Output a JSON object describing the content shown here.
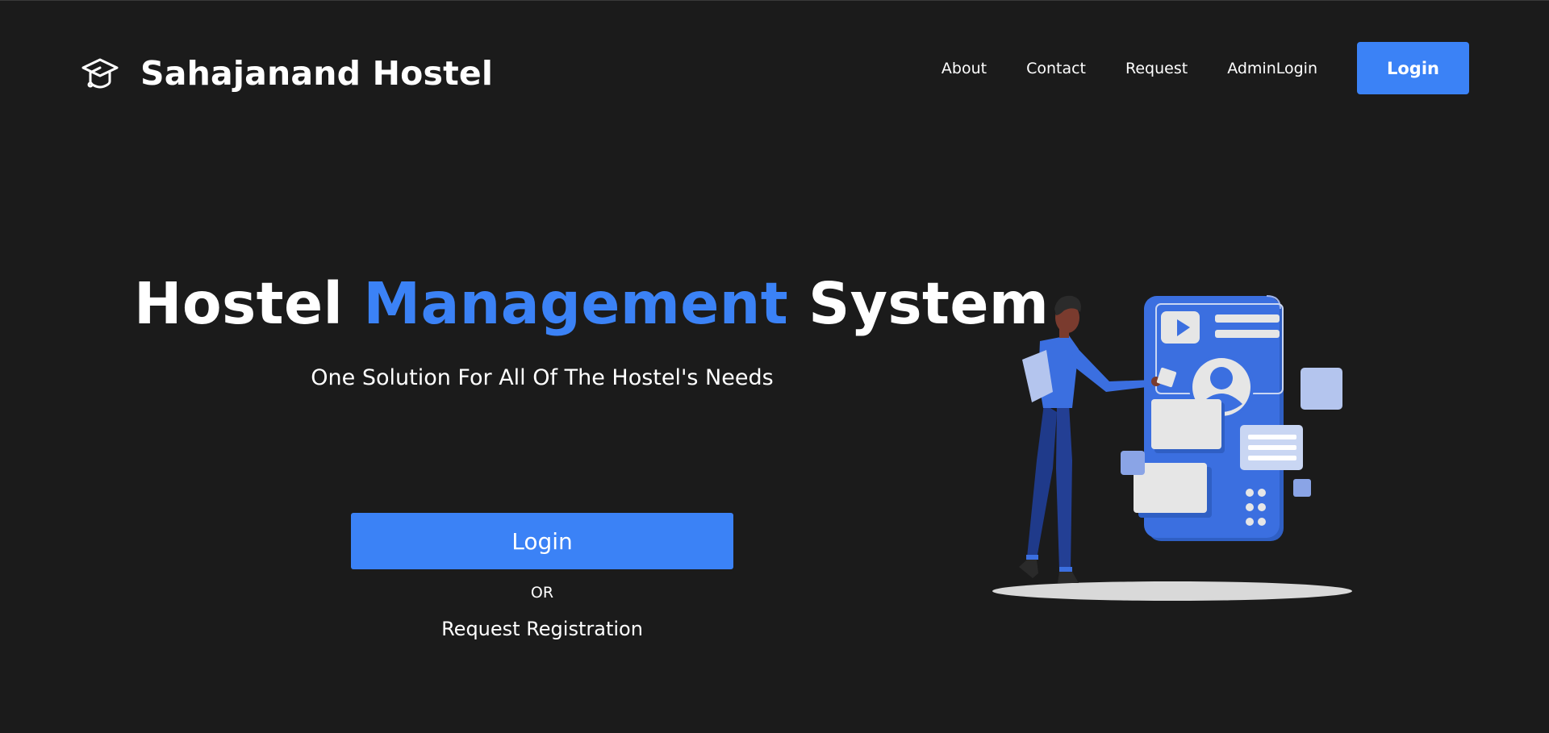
{
  "header": {
    "brand_name": "Sahajanand Hostel",
    "brand_icon": "graduation-cap-icon",
    "nav": [
      {
        "label": "About"
      },
      {
        "label": "Contact"
      },
      {
        "label": "Request"
      },
      {
        "label": "AdminLogin"
      }
    ],
    "login_label": "Login"
  },
  "hero": {
    "title_part1": "Hostel ",
    "title_accent": "Management",
    "title_part2": " System",
    "subtitle": "One Solution For All Of The Hostel's Needs",
    "login_label": "Login",
    "or_text": "OR",
    "request_label": "Request Registration",
    "illustration": "person-with-phone-app-illustration"
  },
  "colors": {
    "background": "#1b1b1b",
    "accent": "#3b82f6",
    "text": "#ffffff"
  }
}
